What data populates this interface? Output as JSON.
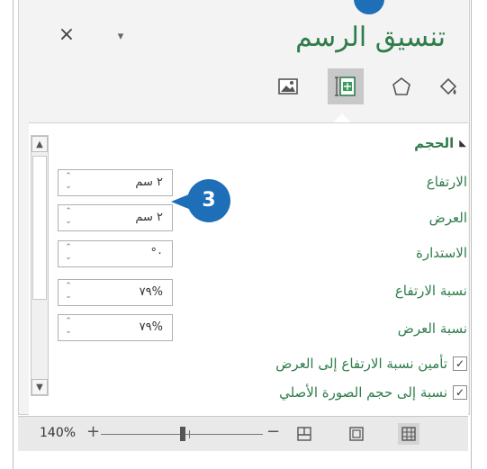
{
  "pane": {
    "title": "تنسيق الرسم",
    "close_label": "×",
    "dropdown_label": "▾"
  },
  "tabs": [
    {
      "icon": "fill-line-icon"
    },
    {
      "icon": "effects-icon"
    },
    {
      "icon": "size-properties-icon",
      "selected": true
    },
    {
      "icon": "picture-icon"
    }
  ],
  "size_section": {
    "heading": "الحجم",
    "fields": [
      {
        "label": "الارتفاع",
        "value": "٢ سم"
      },
      {
        "label": "العرض",
        "value": "٢ سم"
      },
      {
        "label": "الاستدارة",
        "value": "٠°"
      },
      {
        "label": "نسبة الارتفاع",
        "value": "%٧٩"
      },
      {
        "label": "نسبة العرض",
        "value": "%٧٩"
      }
    ],
    "checkboxes": [
      {
        "label": "تأمين نسبة الارتفاع إلى العرض",
        "checked": true
      },
      {
        "label": "نسبة إلى حجم الصورة الأصلي",
        "checked": true
      }
    ]
  },
  "callout": {
    "number": "3"
  },
  "statusbar": {
    "zoom": "140%",
    "zoom_plus": "+",
    "zoom_minus": "−"
  },
  "colors": {
    "accent_green": "#2e7d4a",
    "callout_blue": "#1e6fb8"
  }
}
